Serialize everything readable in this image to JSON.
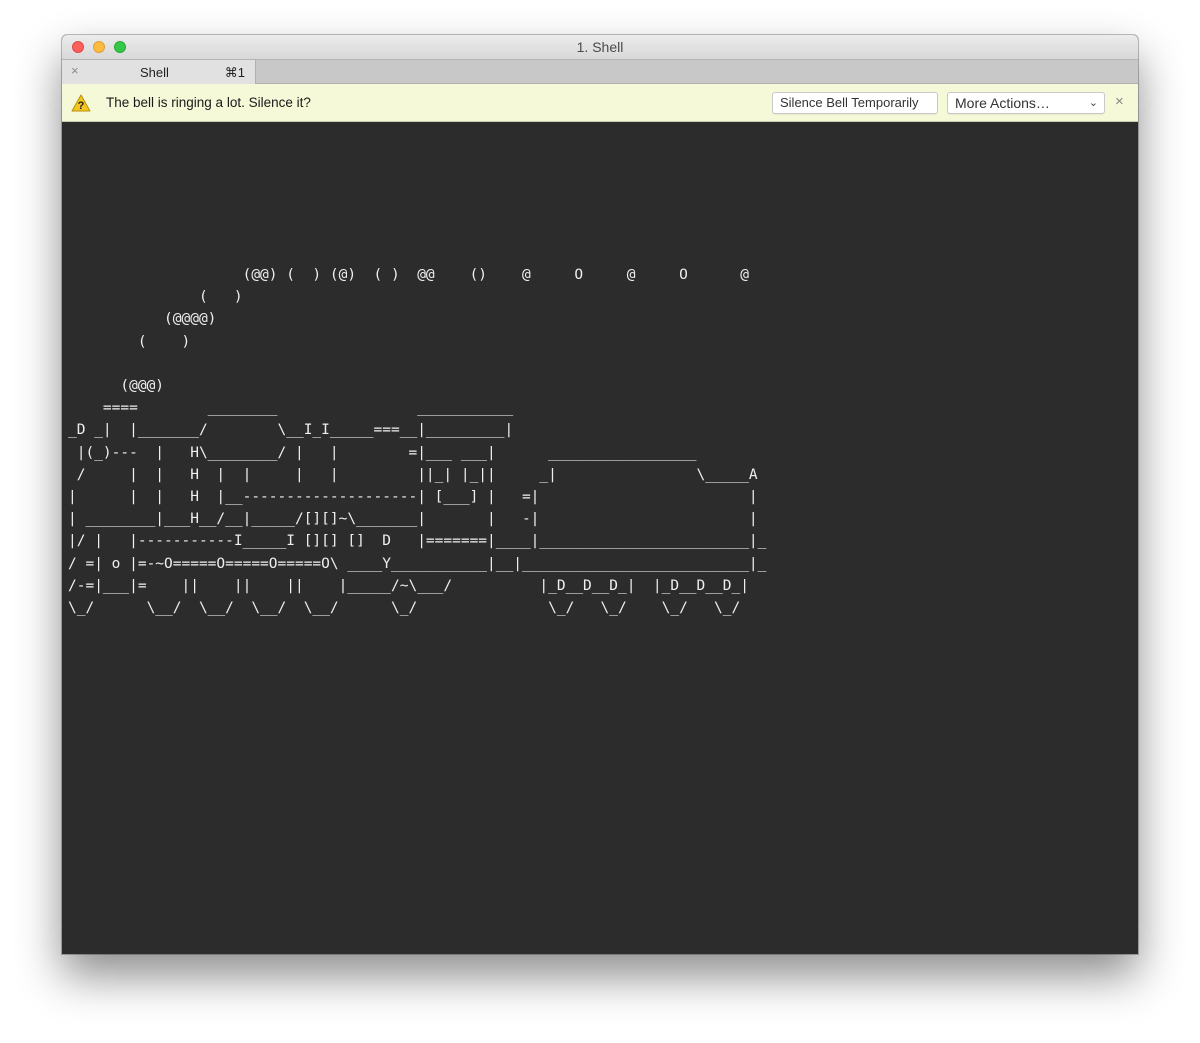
{
  "window": {
    "title": "1. Shell"
  },
  "tabs": [
    {
      "label": "Shell",
      "shortcut": "⌘1",
      "close_glyph": "×"
    }
  ],
  "notice": {
    "icon": "warning-icon",
    "message": "The bell is ringing a lot. Silence it?",
    "silence_button": "Silence Bell Temporarily",
    "more_actions": "More Actions…",
    "close_glyph": "×"
  },
  "terminal": {
    "lines": [
      "                    (@@) (  ) (@)  ( )  @@    ()    @     O     @     O      @",
      "               (   )",
      "           (@@@@)",
      "        (    )",
      "",
      "      (@@@)",
      "    ====        ________                ___________",
      "_D _|  |_______/        \\__I_I_____===__|_________|",
      " |(_)---  |   H\\________/ |   |        =|___ ___|      _________________",
      " /     |  |   H  |  |     |   |         ||_| |_||     _|                \\_____A",
      "|      |  |   H  |__--------------------| [___] |   =|                        |",
      "| ________|___H__/__|_____/[][]~\\_______|       |   -|                        |",
      "|/ |   |-----------I_____I [][] []  D   |=======|____|________________________|_",
      "/ =| o |=-~O=====O=====O=====O\\ ____Y___________|__|__________________________|_",
      "/-=|___|=    ||    ||    ||    |_____/~\\___/          |_D__D__D_|  |_D__D__D_|",
      "\\_/      \\__/  \\__/  \\__/  \\__/      \\_/               \\_/   \\_/    \\_/   \\_/"
    ]
  },
  "colors": {
    "terminal_bg": "#2c2c2c",
    "terminal_fg": "#efefef",
    "notice_bg": "#f5f9d8",
    "warning_yellow": "#f4c61f"
  }
}
